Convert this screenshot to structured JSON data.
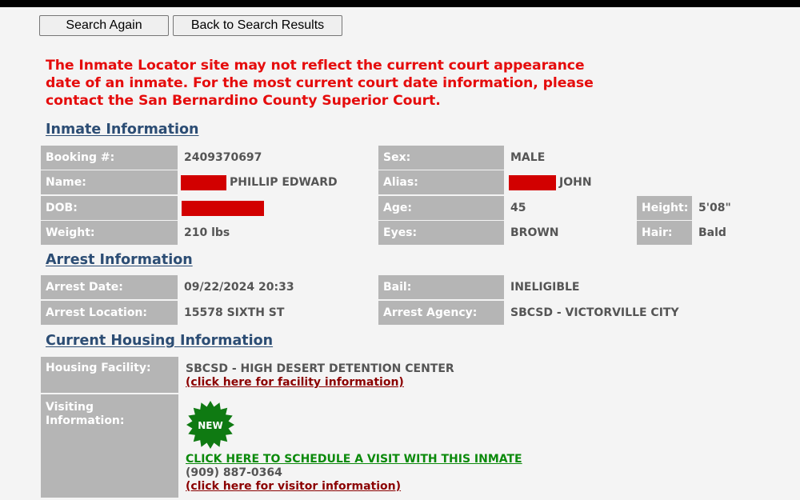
{
  "toolbar": {
    "search_again_label": "Search Again",
    "back_label": "Back to Search Results"
  },
  "notice": "The Inmate Locator site may not reflect the current court appearance date of an inmate. For the most current court date information, please contact the San Bernardino County Superior Court.",
  "colors": {
    "notice": "#e50c0c",
    "section_title": "#2c4d74",
    "label_bg": "#b5b5b5",
    "redaction": "#d20000",
    "link_red": "#8b0000",
    "link_green": "#0b8a0b",
    "badge": "#0f7a12"
  },
  "inmate": {
    "title": "Inmate Information",
    "booking_label": "Booking #:",
    "booking": "2409370697",
    "name_label": "Name:",
    "name": "PHILLIP EDWARD",
    "dob_label": "DOB:",
    "weight_label": "Weight:",
    "weight": "210 lbs",
    "sex_label": "Sex:",
    "sex": "MALE",
    "alias_label": "Alias:",
    "alias": "JOHN",
    "age_label": "Age:",
    "age": "45",
    "eyes_label": "Eyes:",
    "eyes": "BROWN",
    "height_label": "Height:",
    "height": "5'08\"",
    "hair_label": "Hair:",
    "hair": "Bald"
  },
  "arrest": {
    "title": "Arrest Information",
    "date_label": "Arrest Date:",
    "date": "09/22/2024 20:33",
    "location_label": "Arrest Location:",
    "location": "15578 SIXTH ST",
    "bail_label": "Bail:",
    "bail": "INELIGIBLE",
    "agency_label": "Arrest Agency:",
    "agency": "SBCSD - VICTORVILLE CITY"
  },
  "housing": {
    "title": "Current Housing Information",
    "facility_label": "Housing Facility:",
    "facility": "SBCSD - HIGH DESERT DETENTION CENTER",
    "facility_link": "(click here for facility information)",
    "visiting_label": "Visiting Information:",
    "badge_text": "NEW",
    "schedule_link": "CLICK HERE TO SCHEDULE A VISIT WITH THIS INMATE",
    "phone": "(909) 887-0364",
    "visitor_link": "(click here for visitor information)"
  }
}
